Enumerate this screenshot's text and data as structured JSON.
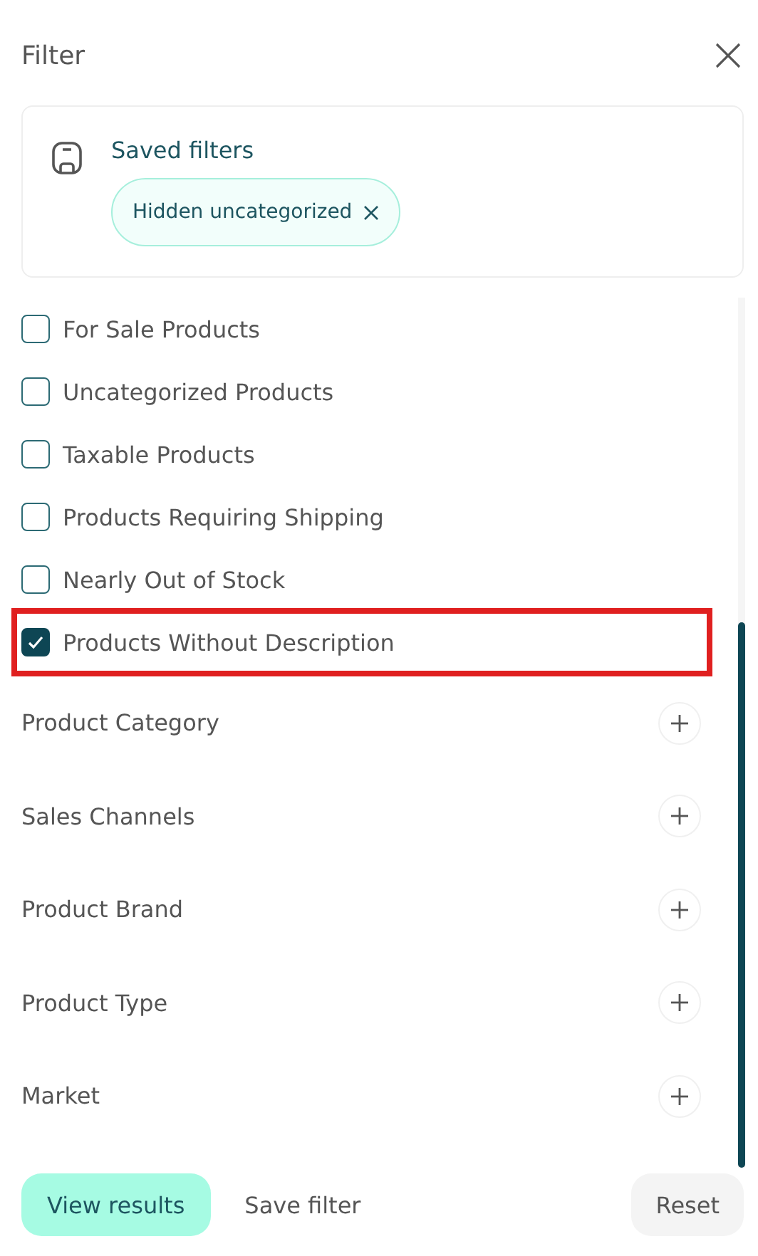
{
  "title": "Filter",
  "saved_filters": {
    "heading": "Saved filters",
    "chips": [
      {
        "label": "Hidden uncategorized"
      }
    ]
  },
  "options": [
    {
      "label": "For Sale Products",
      "checked": false,
      "highlighted": false
    },
    {
      "label": "Uncategorized Products",
      "checked": false,
      "highlighted": false
    },
    {
      "label": "Taxable Products",
      "checked": false,
      "highlighted": false
    },
    {
      "label": "Products Requiring Shipping",
      "checked": false,
      "highlighted": false
    },
    {
      "label": "Nearly Out of Stock",
      "checked": false,
      "highlighted": false
    },
    {
      "label": "Products Without Description",
      "checked": true,
      "highlighted": true
    }
  ],
  "sections": [
    {
      "label": "Product Category",
      "expanded": false
    },
    {
      "label": "Sales Channels",
      "expanded": false
    },
    {
      "label": "Product Brand",
      "expanded": false
    },
    {
      "label": "Product Type",
      "expanded": false
    },
    {
      "label": "Market",
      "expanded": false
    }
  ],
  "footer": {
    "primary": "View results",
    "secondary": "Save filter",
    "reset": "Reset"
  }
}
